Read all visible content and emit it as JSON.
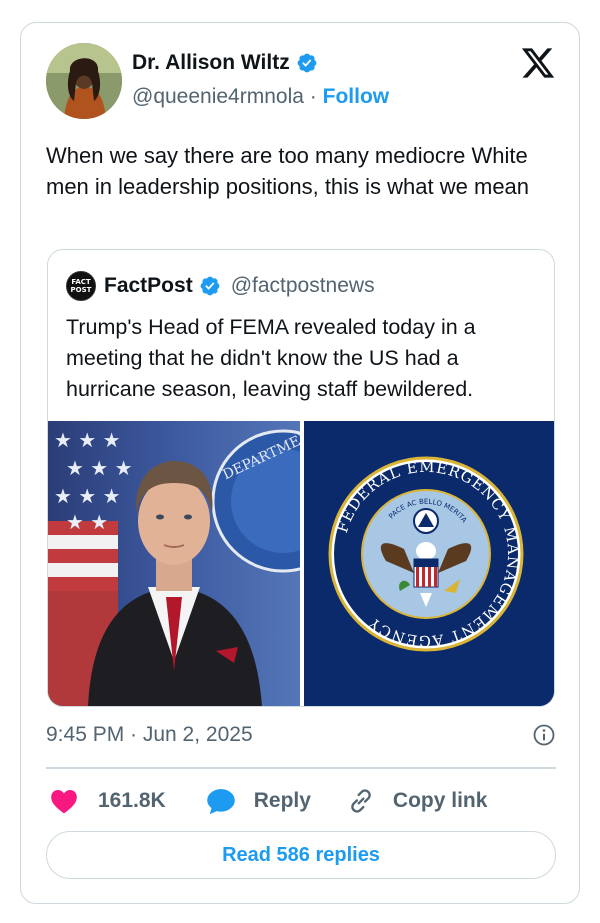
{
  "author": {
    "name": "Dr. Allison Wiltz",
    "handle": "@queenie4rmnola",
    "separator": "·",
    "follow_label": "Follow"
  },
  "tweet": {
    "text": "When we say there are too many mediocre White men in leadership positions, this is what we mean",
    "timestamp": "9:45 PM · Jun 2, 2025"
  },
  "quoted": {
    "logo_text_line1": "FACT",
    "logo_text_line2": "POST",
    "name": "FactPost",
    "handle": "@factpostnews",
    "text": "Trump's Head of FEMA revealed today in a meeting that he didn't know the US had a hurricane season, leaving staff bewildered.",
    "seal_outer_text": "FEDERAL EMERGENCY MANAGEMENT AGENCY",
    "seal_motto": "PACE AC BELLO MERITA",
    "seal_bg_text": "DEPARTMEN"
  },
  "actions": {
    "likes": "161.8K",
    "reply_label": "Reply",
    "copy_label": "Copy link",
    "read_replies_label": "Read 586 replies"
  },
  "colors": {
    "accent": "#1d9bf0",
    "like": "#f91880",
    "text_secondary": "#536471",
    "border": "#cfd9de",
    "fema_blue": "#0a2a6b"
  }
}
